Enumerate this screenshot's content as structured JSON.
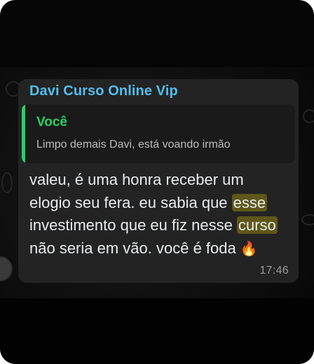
{
  "chat": {
    "sender": "Davi Curso Online Vip",
    "reply": {
      "author": "Você",
      "text": "Limpo demais Davi, está voando irmão"
    },
    "message": {
      "part1": "valeu, é uma honra receber um elogio seu fera. eu sabia que ",
      "highlight1": "esse",
      "part2": " investimento que eu fiz nesse ",
      "highlight2": "curso",
      "part3": " não seria em vão. você é foda ",
      "emoji": "🔥"
    },
    "time": "17:46"
  },
  "colors": {
    "sender": "#53bdeb",
    "reply_accent": "#25d366",
    "bubble": "#232323",
    "highlight": "#5e5718"
  },
  "icons": [
    "fire-emoji-icon"
  ]
}
